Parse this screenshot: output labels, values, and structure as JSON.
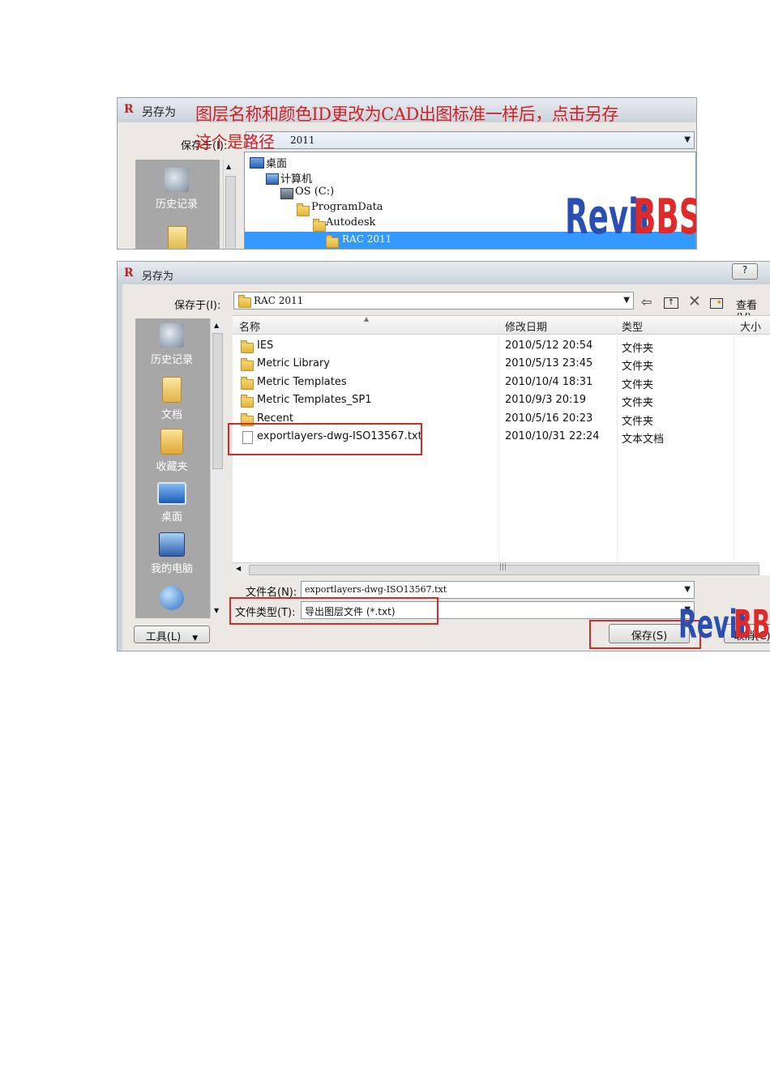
{
  "top_panel": {
    "title": "另存为",
    "annotation_line1": "图层名称和颜色ID更改为CAD出图标准一样后，点击另存",
    "annotation_line2": "这个是路径",
    "save_in_label": "保存于(I):",
    "save_in_value": "2011",
    "sidebar_item": "历史记录",
    "tree": [
      "桌面",
      "计算机",
      "OS (C:)",
      "ProgramData",
      "Autodesk",
      "RAC 2011"
    ],
    "watermark_a": "Revit",
    "watermark_b": "BBS"
  },
  "dialog": {
    "title": "另存为",
    "help": "?",
    "save_in_label": "保存于(I):",
    "save_in_value": "RAC 2011",
    "view_label": "查看(V)",
    "sidebar": [
      {
        "label": "历史记录",
        "icon": "history-icon"
      },
      {
        "label": "文档",
        "icon": "documents-icon"
      },
      {
        "label": "收藏夹",
        "icon": "favorites-icon"
      },
      {
        "label": "桌面",
        "icon": "desktop-icon"
      },
      {
        "label": "我的电脑",
        "icon": "my-computer-icon"
      }
    ],
    "columns": [
      "名称",
      "修改日期",
      "类型",
      "大小"
    ],
    "files": [
      {
        "name": "IES",
        "date": "2010/5/12 20:54",
        "type": "文件夹",
        "icon": "folder"
      },
      {
        "name": "Metric Library",
        "date": "2010/5/13 23:45",
        "type": "文件夹",
        "icon": "folder"
      },
      {
        "name": "Metric Templates",
        "date": "2010/10/4 18:31",
        "type": "文件夹",
        "icon": "folder"
      },
      {
        "name": "Metric Templates_SP1",
        "date": "2010/9/3 20:19",
        "type": "文件夹",
        "icon": "folder"
      },
      {
        "name": "Recent",
        "date": "2010/5/16 20:23",
        "type": "文件夹",
        "icon": "folder"
      },
      {
        "name": "exportlayers-dwg-ISO13567.txt",
        "date": "2010/10/31 22:24",
        "type": "文本文档",
        "icon": "file"
      }
    ],
    "filename_label": "文件名(N):",
    "filename_value": "exportlayers-dwg-ISO13567.txt",
    "filetype_label": "文件类型(T):",
    "filetype_value": "导出图层文件 (*.txt)",
    "tools_label": "工具(L)",
    "save_button": "保存(S)",
    "cancel_button": "取消(C)",
    "watermark_a": "Revit",
    "watermark_b": "BB"
  }
}
